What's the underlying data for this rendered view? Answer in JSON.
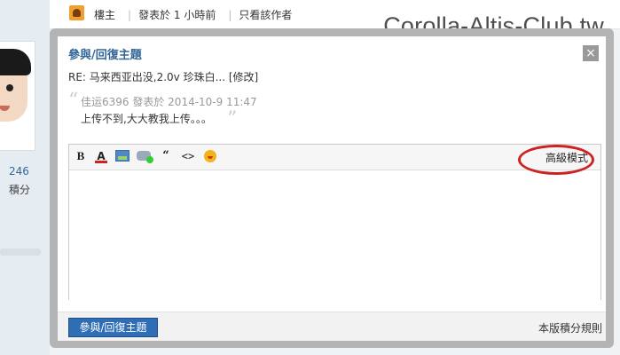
{
  "watermark": "Corolla-Altis-Club.tw",
  "topbar": {
    "role": "樓主",
    "posted": "發表於 1 小時前",
    "only_author": "只看該作者"
  },
  "profile": {
    "count": "246",
    "count_label": "積分"
  },
  "modal": {
    "title": "參與/回復主題",
    "close_label": "×",
    "re_line": "RE: 马来西亚出没,2.0v 珍珠白... [修改]",
    "quote": {
      "meta": "佳运6396 發表於 2014-10-9 11:47",
      "text": "上传不到,大大教我上传。。。"
    },
    "editor": {
      "toolbar": {
        "bold": "B",
        "color": "A",
        "quote": "“",
        "code": "<>"
      },
      "advanced_mode": "高級模式",
      "value": ""
    },
    "footer": {
      "submit": "參與/回復主題",
      "rules": "本版積分規則"
    }
  },
  "colors": {
    "accent": "#336699",
    "button": "#2f6db5",
    "highlight": "#cc2222"
  }
}
